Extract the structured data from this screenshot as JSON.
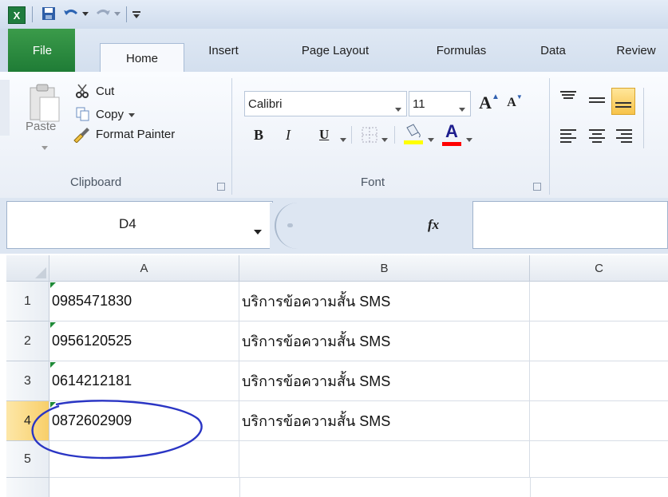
{
  "quick_access": {
    "icons": [
      "excel-icon",
      "save-icon",
      "undo-icon",
      "redo-icon",
      "customize-qat-icon"
    ],
    "app_letter": "X"
  },
  "tabs": {
    "file": "File",
    "items": [
      "Home",
      "Insert",
      "Page Layout",
      "Formulas",
      "Data",
      "Review"
    ],
    "active": "Home"
  },
  "ribbon": {
    "clipboard": {
      "label": "Clipboard",
      "paste": "Paste",
      "cut": "Cut",
      "copy": "Copy",
      "format_painter": "Format Painter"
    },
    "font": {
      "label": "Font",
      "name": "Calibri",
      "size": "11",
      "bold": "B",
      "italic": "I",
      "underline": "U",
      "grow": "A",
      "shrink": "A",
      "color_letter": "A",
      "highlight_color": "#ffff00",
      "font_color": "#ff0000"
    }
  },
  "formula_bar": {
    "name_box": "D4",
    "fx": "fx",
    "formula": ""
  },
  "sheet": {
    "columns": [
      "A",
      "B",
      "C"
    ],
    "rows": [
      {
        "num": "1",
        "a": "0985471830",
        "b": "บริการข้อความสั้น SMS"
      },
      {
        "num": "2",
        "a": "0956120525",
        "b": "บริการข้อความสั้น SMS"
      },
      {
        "num": "3",
        "a": "0614212181",
        "b": "บริการข้อความสั้น SMS"
      },
      {
        "num": "4",
        "a": "0872602909",
        "b": "บริการข้อความสั้น SMS"
      },
      {
        "num": "5",
        "a": "",
        "b": ""
      }
    ],
    "active_row": "4",
    "annotation_color": "#2a35c4"
  }
}
